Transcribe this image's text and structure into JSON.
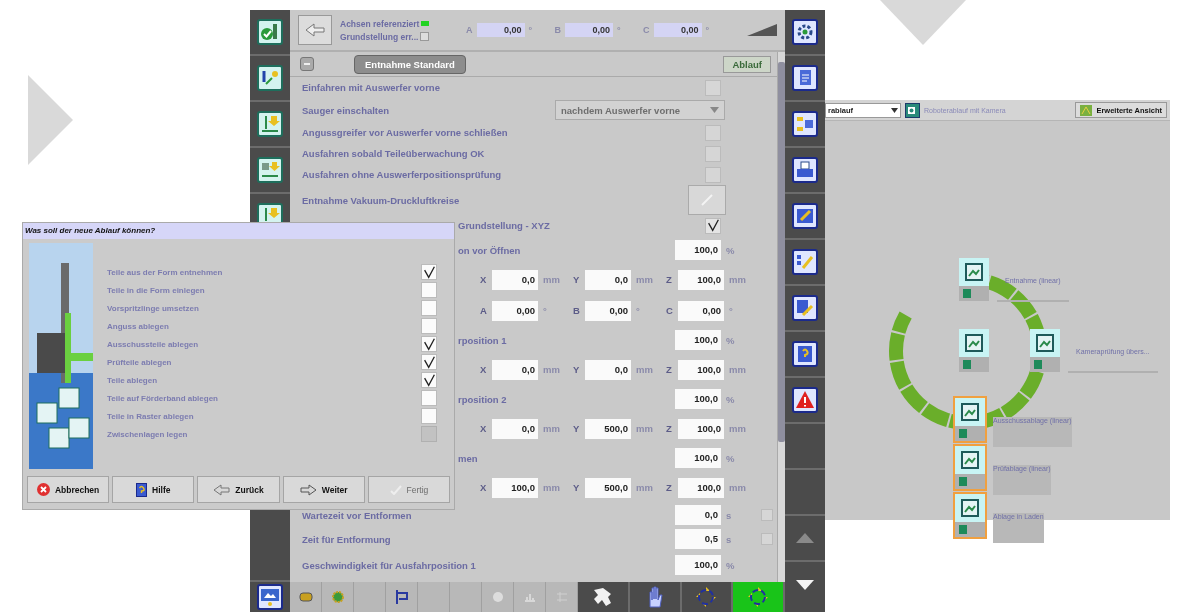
{
  "main_screen": {
    "status": {
      "axes_label": "Achsen referenziert",
      "axes_ok": true,
      "home_label": "Grundstellung err...",
      "home_checked": false,
      "angles": [
        {
          "axis": "A",
          "value": "0,00",
          "unit": "°"
        },
        {
          "axis": "B",
          "value": "0,00",
          "unit": "°"
        },
        {
          "axis": "C",
          "value": "0,00",
          "unit": "°"
        }
      ]
    },
    "section": {
      "title": "Entnahme Standard",
      "expanded": true,
      "button": "Ablauf"
    },
    "rows": [
      {
        "kind": "check",
        "label": "Einfahren mit Auswerfer vorne",
        "checked": false
      },
      {
        "kind": "dropdown",
        "label": "Sauger einschalten",
        "value": "nachdem Auswerfer vorne",
        "disabled": true
      },
      {
        "kind": "check",
        "label": "Angussgreifer vor Auswerfer vorne schließen",
        "checked": false
      },
      {
        "kind": "check",
        "label": "Ausfahren sobald Teileüberwachung OK",
        "checked": false
      },
      {
        "kind": "check",
        "label": "Ausfahren ohne Auswerferpositionsprüfung",
        "checked": false
      },
      {
        "kind": "button",
        "label": "Entnahme Vakuum-Druckluftkreise"
      },
      {
        "kind": "check",
        "label": "Grundstellung - XYZ",
        "clipped": true,
        "checked": true
      },
      {
        "kind": "percent",
        "label": "on vor Öffnen",
        "clipped": true,
        "value": "100,0",
        "unit": "%"
      },
      {
        "kind": "coords",
        "fields": [
          {
            "axis": "X",
            "value": "0,0",
            "unit": "mm"
          },
          {
            "axis": "Y",
            "value": "0,0",
            "unit": "mm"
          },
          {
            "axis": "Z",
            "value": "100,0",
            "unit": "mm"
          }
        ]
      },
      {
        "kind": "coords",
        "fields": [
          {
            "axis": "A",
            "value": "0,00",
            "unit": "°"
          },
          {
            "axis": "B",
            "value": "0,00",
            "unit": "°"
          },
          {
            "axis": "C",
            "value": "0,00",
            "unit": "°"
          }
        ]
      },
      {
        "kind": "percent",
        "label": "rposition 1",
        "clipped": true,
        "value": "100,0",
        "unit": "%"
      },
      {
        "kind": "coords",
        "fields": [
          {
            "axis": "X",
            "value": "0,0",
            "unit": "mm"
          },
          {
            "axis": "Y",
            "value": "0,0",
            "unit": "mm"
          },
          {
            "axis": "Z",
            "value": "100,0",
            "unit": "mm"
          }
        ]
      },
      {
        "kind": "percent",
        "label": "rposition 2",
        "clipped": true,
        "value": "100,0",
        "unit": "%"
      },
      {
        "kind": "coords",
        "fields": [
          {
            "axis": "X",
            "value": "0,0",
            "unit": "mm"
          },
          {
            "axis": "Y",
            "value": "500,0",
            "unit": "mm"
          },
          {
            "axis": "Z",
            "value": "100,0",
            "unit": "mm"
          }
        ]
      },
      {
        "kind": "percent",
        "label": "men",
        "clipped": true,
        "value": "100,0",
        "unit": "%"
      },
      {
        "kind": "coords",
        "fields": [
          {
            "axis": "X",
            "value": "100,0",
            "unit": "mm"
          },
          {
            "axis": "Y",
            "value": "500,0",
            "unit": "mm"
          },
          {
            "axis": "Z",
            "value": "100,0",
            "unit": "mm"
          }
        ]
      },
      {
        "kind": "time",
        "label": "Wartezeit vor Entformen",
        "value": "0,0",
        "unit": "s",
        "checked": false
      },
      {
        "kind": "time",
        "label": "Zeit für Entformung",
        "value": "0,5",
        "unit": "s",
        "checked": false
      },
      {
        "kind": "percent",
        "label": "Geschwindigkeit für Ausfahrposition 1",
        "value": "100,0",
        "unit": "%"
      }
    ],
    "mode_buttons": [
      {
        "selected": false
      },
      {
        "selected": false
      },
      {
        "selected": false
      },
      {
        "selected": true
      }
    ]
  },
  "dialog": {
    "title": "Was soll der neue Ablauf können?",
    "options": [
      {
        "label": "Teile aus der Form entnehmen",
        "checked": true,
        "disabled": false
      },
      {
        "label": "Teile in die Form einlegen",
        "checked": false,
        "disabled": false
      },
      {
        "label": "Vorspritzlinge umsetzen",
        "checked": false,
        "disabled": false
      },
      {
        "label": "Anguss ablegen",
        "checked": false,
        "disabled": false
      },
      {
        "label": "Ausschussteile ablegen",
        "checked": true,
        "disabled": false
      },
      {
        "label": "Prüfteile ablegen",
        "checked": true,
        "disabled": false
      },
      {
        "label": "Teile ablegen",
        "checked": true,
        "disabled": false
      },
      {
        "label": "Teile auf Förderband ablegen",
        "checked": false,
        "disabled": false
      },
      {
        "label": "Teile in Raster ablegen",
        "checked": false,
        "disabled": false
      },
      {
        "label": "Zwischenlagen legen",
        "checked": false,
        "disabled": true
      }
    ],
    "buttons": [
      {
        "kind": "cancel",
        "label": "Abbrechen",
        "disabled": false
      },
      {
        "kind": "help",
        "label": "Hilfe",
        "disabled": false
      },
      {
        "kind": "back",
        "label": "Zurück",
        "disabled": false
      },
      {
        "kind": "next",
        "label": "Weiter",
        "disabled": false
      },
      {
        "kind": "finish",
        "label": "Fertig",
        "disabled": true
      }
    ]
  },
  "sequence_panel": {
    "dropdown": {
      "value": "rablauf"
    },
    "sequence_name": "Roboterablauf mit Kamera",
    "view_button": "Erweiterte Ansicht",
    "nodes": [
      {
        "label": "Entnahme (linear)",
        "selected": false
      },
      {
        "selected": false
      },
      {
        "label": "Kameraprüfung übers...",
        "selected": false
      },
      {
        "label": "Ausschussablage (linear)",
        "selected": true
      },
      {
        "label": "Prüfablage (linear)",
        "selected": true
      },
      {
        "label": "Ablage in Laden",
        "selected": true
      }
    ]
  }
}
